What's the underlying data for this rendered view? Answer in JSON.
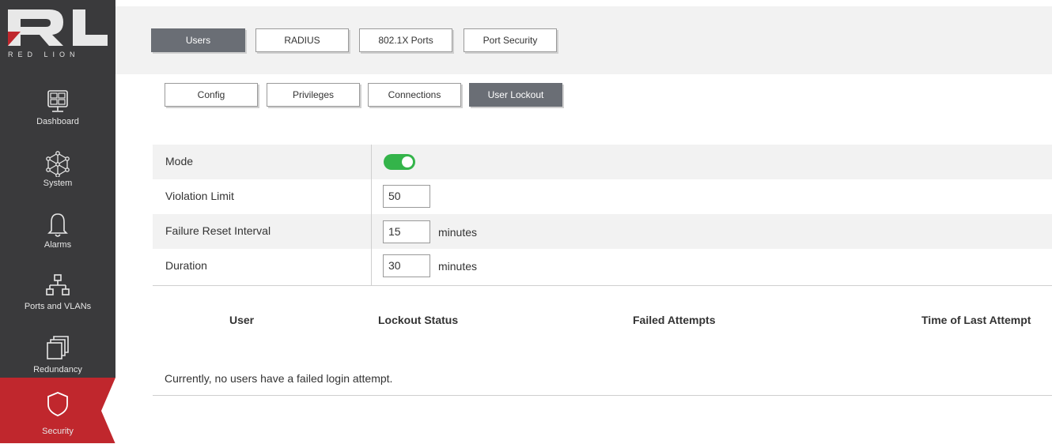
{
  "brand": {
    "logo_text": "RL",
    "name": "RED LION"
  },
  "sidebar": {
    "items": [
      {
        "label": "Dashboard",
        "icon": "dashboard-icon"
      },
      {
        "label": "System",
        "icon": "network-nodes-icon"
      },
      {
        "label": "Alarms",
        "icon": "bell-icon"
      },
      {
        "label": "Ports and VLANs",
        "icon": "topology-icon"
      },
      {
        "label": "Redundancy",
        "icon": "stacked-windows-icon"
      },
      {
        "label": "Security",
        "icon": "shield-icon",
        "active": true
      }
    ]
  },
  "tabs_primary": [
    "Users",
    "RADIUS",
    "802.1X Ports",
    "Port Security"
  ],
  "tabs_primary_active": "Users",
  "tabs_secondary": [
    "Config",
    "Privileges",
    "Connections",
    "User Lockout"
  ],
  "tabs_secondary_active": "User Lockout",
  "settings": {
    "mode": {
      "label": "Mode",
      "enabled": true
    },
    "violation_limit": {
      "label": "Violation Limit",
      "value": "50"
    },
    "failure_reset_interval": {
      "label": "Failure Reset Interval",
      "value": "15",
      "unit": "minutes"
    },
    "duration": {
      "label": "Duration",
      "value": "30",
      "unit": "minutes"
    }
  },
  "lockout_table": {
    "columns": [
      "User",
      "Lockout Status",
      "Failed Attempts",
      "Time of Last Attempt"
    ],
    "empty_message": "Currently, no users have a failed login attempt."
  },
  "colors": {
    "sidebar_bg": "#3a3a3c",
    "active_red": "#c0272d",
    "active_tab": "#6a6e75",
    "toggle_on": "#34b44a"
  }
}
